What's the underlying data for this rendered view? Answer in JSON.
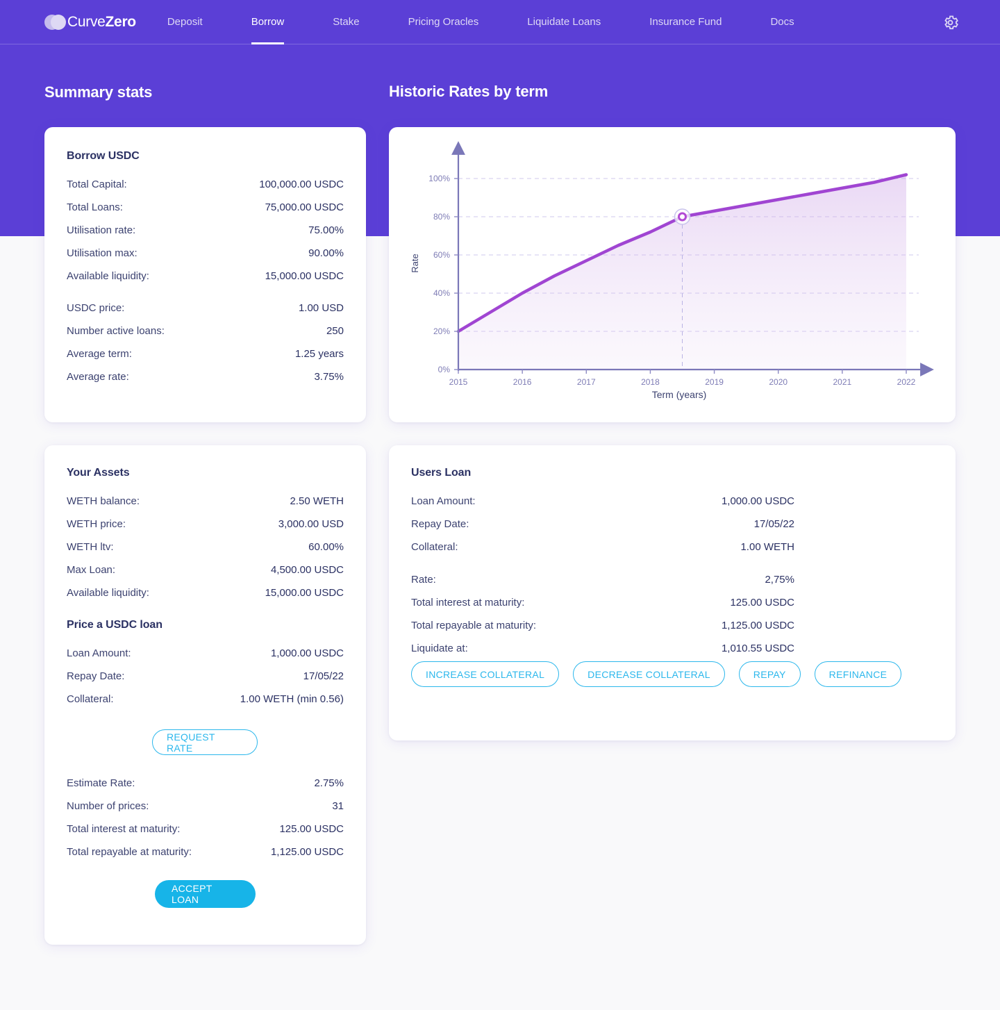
{
  "brand": {
    "name_part1": "Curve",
    "name_part2": "Zero",
    "logo_icon": "two-overlapping-circles-icon"
  },
  "nav": {
    "items": [
      {
        "label": "Deposit",
        "active": false
      },
      {
        "label": "Borrow",
        "active": true
      },
      {
        "label": "Stake",
        "active": false
      },
      {
        "label": "Pricing Oracles",
        "active": false
      },
      {
        "label": "Liquidate Loans",
        "active": false
      },
      {
        "label": "Insurance Fund",
        "active": false
      },
      {
        "label": "Docs",
        "active": false
      }
    ],
    "settings_icon": "gear-icon"
  },
  "sections": {
    "summary_title": "Summary stats",
    "historic_title": "Historic Rates by term"
  },
  "borrow_card": {
    "title": "Borrow USDC",
    "rows": [
      {
        "label": "Total Capital:",
        "value": "100,000.00 USDC"
      },
      {
        "label": "Total Loans:",
        "value": "75,000.00 USDC"
      },
      {
        "label": "Utilisation rate:",
        "value": "75.00%"
      },
      {
        "label": "Utilisation max:",
        "value": "90.00%"
      },
      {
        "label": "Available liquidity:",
        "value": "15,000.00 USDC"
      }
    ],
    "rows2": [
      {
        "label": "USDC price:",
        "value": "1.00 USD"
      },
      {
        "label": "Number active loans:",
        "value": "250"
      },
      {
        "label": "Average term:",
        "value": "1.25 years"
      },
      {
        "label": "Average rate:",
        "value": "3.75%"
      }
    ]
  },
  "assets_card": {
    "title": "Your Assets",
    "rows": [
      {
        "label": "WETH balance:",
        "value": "2.50 WETH"
      },
      {
        "label": "WETH price:",
        "value": "3,000.00 USD"
      },
      {
        "label": "WETH ltv:",
        "value": "60.00%"
      },
      {
        "label": "Max Loan:",
        "value": "4,500.00 USDC"
      },
      {
        "label": "Available liquidity:",
        "value": "15,000.00 USDC"
      }
    ]
  },
  "price_loan_card": {
    "title": "Price a USDC loan",
    "rows": [
      {
        "label": "Loan Amount:",
        "value": "1,000.00 USDC"
      },
      {
        "label": "Repay Date:",
        "value": "17/05/22"
      },
      {
        "label": "Collateral:",
        "value": "1.00 WETH (min 0.56)"
      }
    ],
    "request_rate_label": "REQUEST RATE",
    "rows2": [
      {
        "label": "Estimate Rate:",
        "value": "2.75%"
      },
      {
        "label": "Number of prices:",
        "value": "31"
      },
      {
        "label": "Total interest at maturity:",
        "value": "125.00 USDC"
      },
      {
        "label": "Total repayable at maturity:",
        "value": "1,125.00 USDC"
      }
    ],
    "accept_loan_label": "ACCEPT LOAN"
  },
  "users_loan_card": {
    "title": "Users Loan",
    "rows": [
      {
        "label": "Loan Amount:",
        "value": "1,000.00 USDC"
      },
      {
        "label": "Repay Date:",
        "value": "17/05/22"
      },
      {
        "label": "Collateral:",
        "value": "1.00 WETH"
      }
    ],
    "rows2": [
      {
        "label": "Rate:",
        "value": "2,75%"
      },
      {
        "label": "Total interest at maturity:",
        "value": "125.00 USDC"
      },
      {
        "label": "Total repayable at maturity:",
        "value": "1,125.00 USDC"
      },
      {
        "label": "Liquidate at:",
        "value": "1,010.55 USDC"
      }
    ],
    "actions": [
      {
        "label": "INCREASE COLLATERAL"
      },
      {
        "label": "DECREASE COLLATERAL"
      },
      {
        "label": "REPAY"
      },
      {
        "label": "REFINANCE"
      }
    ]
  },
  "colors": {
    "brand_purple": "#5b3fd6",
    "accent_cyan": "#17b4e8",
    "chart_line": "#a045d2",
    "text_dark": "#2b3163",
    "page_bg": "#f9f9fa"
  },
  "chart_data": {
    "type": "area",
    "title": "Historic Rates by term",
    "xlabel": "Term (years)",
    "ylabel": "Rate",
    "xlim": [
      2015,
      2022
    ],
    "ylim": [
      0,
      110
    ],
    "xticks": [
      "2015",
      "2016",
      "2017",
      "2018",
      "2019",
      "2020",
      "2021",
      "2022"
    ],
    "yticks": [
      "0%",
      "20%",
      "40%",
      "60%",
      "80%",
      "100%"
    ],
    "grid": true,
    "legend": "none",
    "series": [
      {
        "name": "Rate",
        "x": [
          2015,
          2015.5,
          2016,
          2016.5,
          2017,
          2017.5,
          2018,
          2018.5,
          2019,
          2019.5,
          2020,
          2020.5,
          2021,
          2021.5,
          2022
        ],
        "values": [
          20,
          30,
          40,
          49,
          57,
          65,
          72,
          80,
          83,
          86,
          89,
          92,
          95,
          98,
          102
        ]
      }
    ],
    "marker": {
      "x": 2018.5,
      "y": 80,
      "label": "80%"
    }
  }
}
